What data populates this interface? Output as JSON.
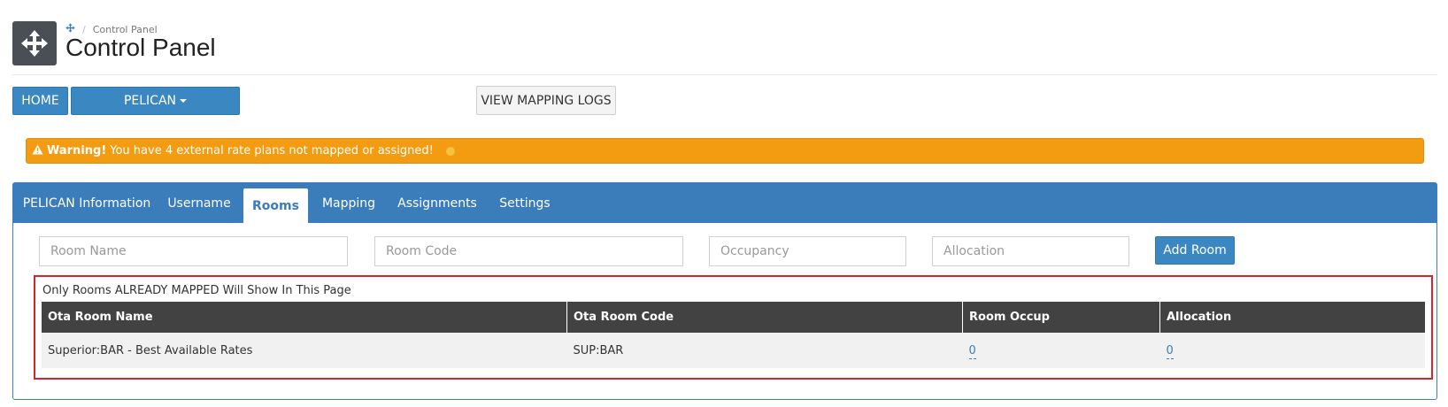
{
  "header": {
    "logo_icon": "move-arrows-icon",
    "breadcrumb_icon": "move-arrows-icon",
    "breadcrumb_current": "Control Panel",
    "title": "Control Panel"
  },
  "toolbar": {
    "home_label": "HOME",
    "property_label": "PELICAN",
    "mapping_logs_label": "VIEW MAPPING LOGS"
  },
  "warning": {
    "icon": "warning-triangle-icon",
    "strong": "Warning!",
    "message": "You have 4 external rate plans not mapped or assigned!",
    "color": "#f39c12"
  },
  "tabs": [
    {
      "label": "PELICAN Information"
    },
    {
      "label": "Username"
    },
    {
      "label": "Rooms",
      "active": true
    },
    {
      "label": "Mapping"
    },
    {
      "label": "Assignments"
    },
    {
      "label": "Settings"
    }
  ],
  "form": {
    "room_name_placeholder": "Room Name",
    "room_code_placeholder": "Room Code",
    "occupancy_placeholder": "Occupancy",
    "allocation_placeholder": "Allocation",
    "add_label": "Add Room"
  },
  "mapped": {
    "note": "Only Rooms ALREADY MAPPED Will Show In This Page",
    "columns": [
      "Ota Room Name",
      "Ota Room Code",
      "Room Occup",
      "Allocation"
    ],
    "rows": [
      {
        "name": "Superior:BAR - Best Available Rates",
        "code": "SUP:BAR",
        "occupancy": "0",
        "allocation": "0"
      }
    ]
  },
  "colors": {
    "primary": "#3b87c1",
    "tab_bar": "#3a7dba",
    "table_header": "#424242",
    "highlight_border": "#d6242a"
  }
}
